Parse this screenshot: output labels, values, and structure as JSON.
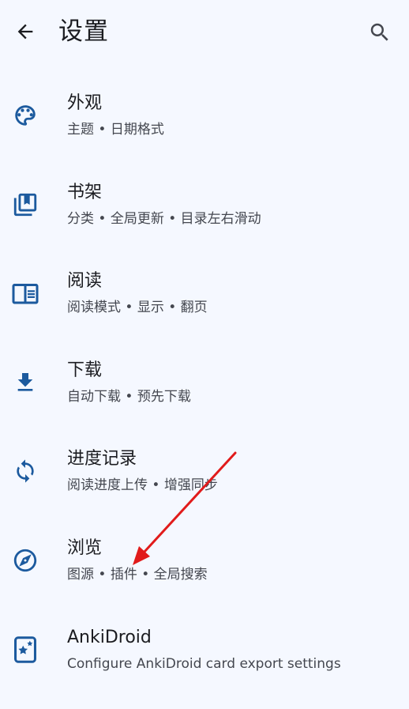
{
  "colors": {
    "background": "#f5f8ff",
    "icon": "#1c5a9e",
    "title": "#1b1c20",
    "subtitle": "#44474f",
    "annotation_arrow": "#e11b1b"
  },
  "header": {
    "title": "设置",
    "back_icon": "arrow-left-icon",
    "search_icon": "search-icon"
  },
  "items": [
    {
      "icon": "palette-icon",
      "title": "外观",
      "subtitle": "主题 • 日期格式"
    },
    {
      "icon": "library-books-icon",
      "title": "书架",
      "subtitle": "分类 • 全局更新 • 目录左右滑动"
    },
    {
      "icon": "chrome-reader-mode-icon",
      "title": "阅读",
      "subtitle": "阅读模式 • 显示 • 翻页"
    },
    {
      "icon": "download-icon",
      "title": "下载",
      "subtitle": "自动下载 • 预先下载"
    },
    {
      "icon": "sync-icon",
      "title": "进度记录",
      "subtitle": "阅读进度上传 • 增强同步"
    },
    {
      "icon": "compass-icon",
      "title": "浏览",
      "subtitle": "图源 • 插件 • 全局搜索"
    },
    {
      "icon": "anki-card-icon",
      "title": "AnkiDroid",
      "subtitle": "Configure AnkiDroid card export settings"
    }
  ]
}
